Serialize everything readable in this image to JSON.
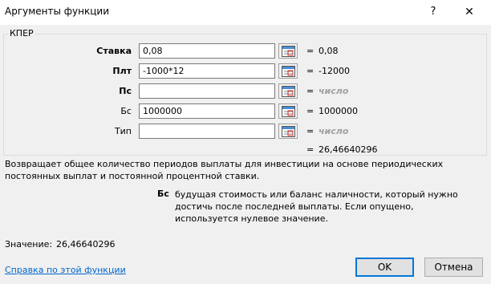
{
  "window": {
    "title": "Аргументы функции",
    "help_glyph": "?",
    "close_glyph": "✕"
  },
  "function": {
    "name": "КПЕР"
  },
  "arguments": [
    {
      "label": "Ставка",
      "bold": true,
      "value": "0,08",
      "result": "0,08"
    },
    {
      "label": "Плт",
      "bold": true,
      "value": "-1000*12",
      "result": "-12000"
    },
    {
      "label": "Пс",
      "bold": true,
      "value": "",
      "result": "число"
    },
    {
      "label": "Бс",
      "bold": false,
      "value": "1000000",
      "result": "1000000"
    },
    {
      "label": "Тип",
      "bold": false,
      "value": "",
      "result": "число"
    }
  ],
  "equals": "=",
  "formula_result": "26,46640296",
  "description": "Возвращает общее количество периодов выплаты для инвестиции на основе периодических постоянных выплат и постоянной процентной ставки.",
  "argument_help": {
    "name": "Бс",
    "text": "будущая стоимость или баланс наличности, который нужно достичь после последней выплаты. Если опущено, используется нулевое значение."
  },
  "value_line": {
    "label": "Значение:",
    "value": "26,46640296"
  },
  "help_link": "Справка по этой функции",
  "buttons": {
    "ok": "OK",
    "cancel": "Отмена"
  }
}
